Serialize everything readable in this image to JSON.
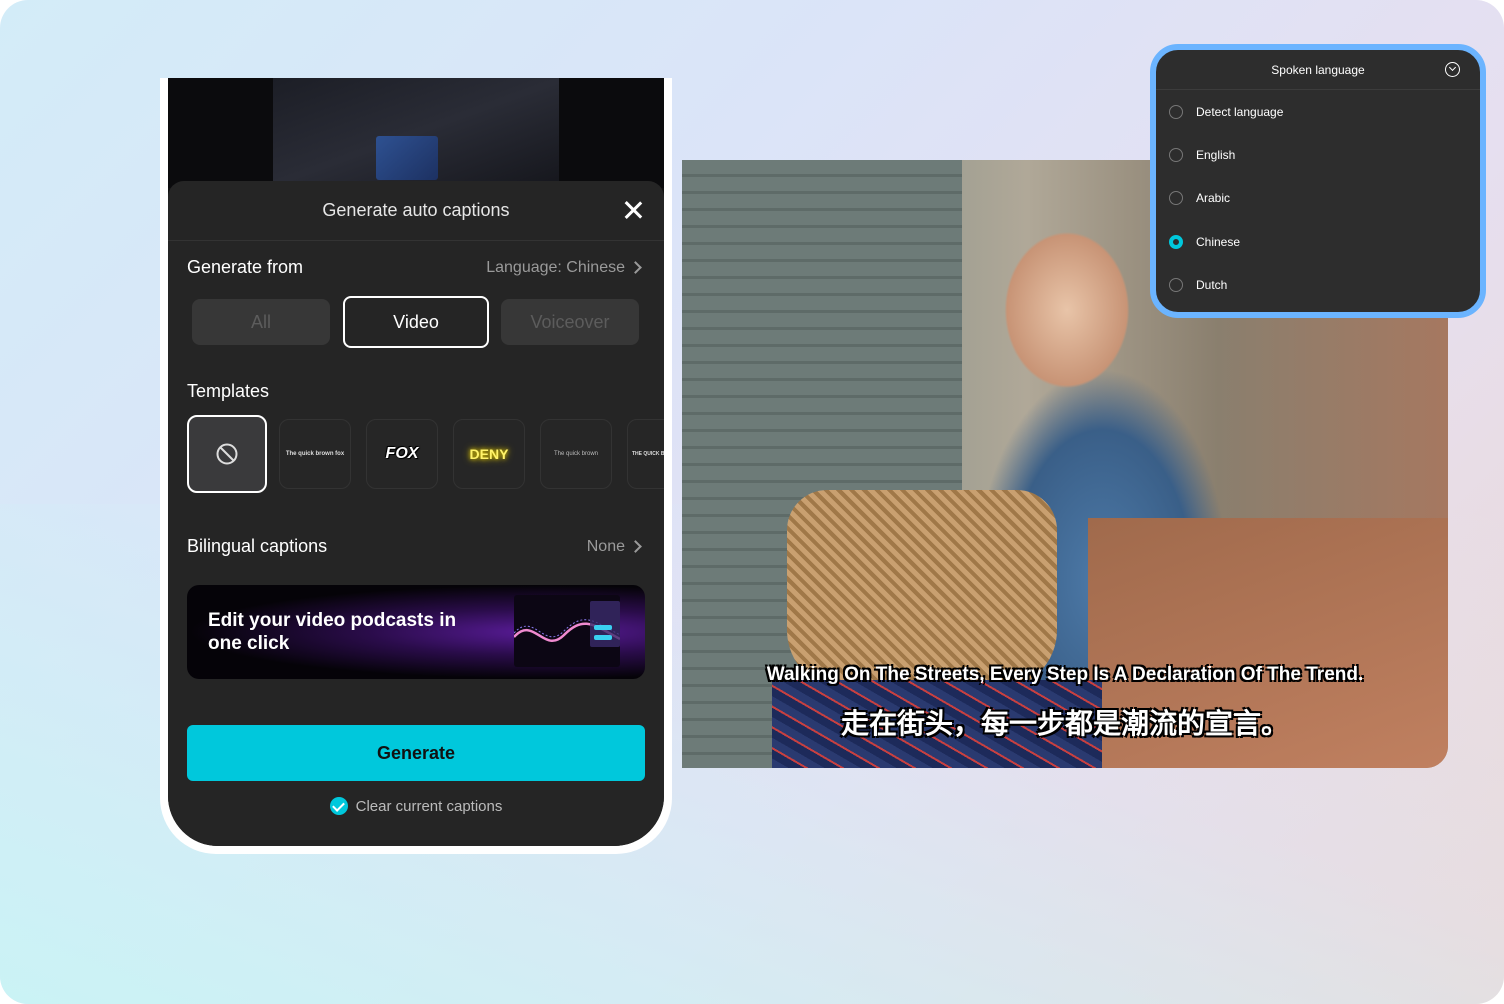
{
  "dialog": {
    "title": "Generate auto captions",
    "generate_from_label": "Generate from",
    "language_value": "Language: Chinese",
    "sources": [
      "All",
      "Video",
      "Voiceover"
    ],
    "selected_source": "Video",
    "templates_label": "Templates",
    "templates": [
      "none",
      "The quick brown fox",
      "FOX",
      "DENY",
      "The quick brown",
      "THE QUICK B"
    ],
    "bilingual_label": "Bilingual captions",
    "bilingual_value": "None",
    "banner_text": "Edit your video podcasts in one click",
    "generate_label": "Generate",
    "clear_label": "Clear current captions",
    "clear_checked": true,
    "accent": "#00c8dc"
  },
  "video": {
    "caption_en": "Walking On The Streets, Every Step Is A Declaration Of The Trend.",
    "caption_zh": "走在街头，每一步都是潮流的宣言。"
  },
  "language_popup": {
    "title": "Spoken language",
    "options": [
      "Detect language",
      "English",
      "Arabic",
      "Chinese",
      "Dutch"
    ],
    "selected": "Chinese",
    "border_color": "#6bb4ff"
  }
}
